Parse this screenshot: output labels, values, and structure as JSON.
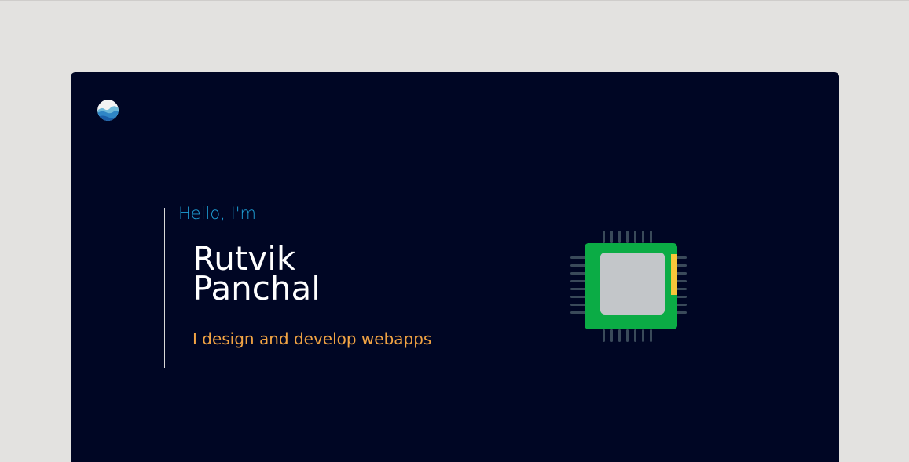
{
  "hero": {
    "greeting": "Hello, I'm",
    "name_first": "Rutvik",
    "name_last": "Panchal",
    "tagline": "I design and develop webapps"
  },
  "icons": {
    "logo": "wave-circle-logo",
    "illustration": "microchip-icon"
  },
  "colors": {
    "page_background": "#e3e2e0",
    "card_background": "#000624",
    "greeting": "#1e9fd6",
    "name": "#ffffff",
    "tagline": "#f2a444",
    "chip_board": "#0bac45",
    "chip_core": "#c3c6c9",
    "chip_pins": "#3a4a5a",
    "chip_accent": "#f7c63a"
  }
}
